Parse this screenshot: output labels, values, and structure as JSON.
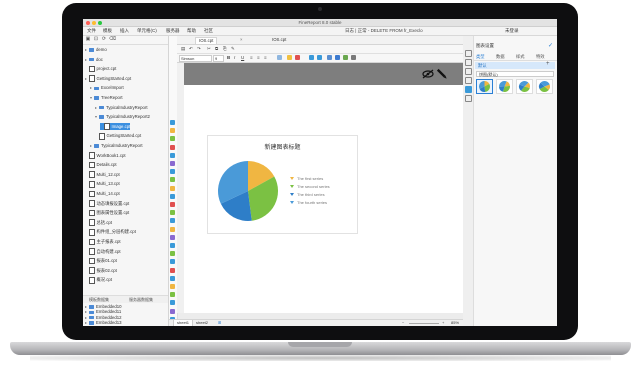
{
  "window": {
    "title": "FineReport 8.0 stable",
    "search_text": "日志 | 正常 - DELETE FROM fr_Execlo",
    "right_header": "未登录"
  },
  "menu": [
    "文件",
    "模板",
    "插入",
    "单元格(C)",
    "服务器",
    "帮助",
    "社区"
  ],
  "left_panel": {
    "tree": [
      {
        "label": "demo",
        "type": "folder",
        "level": 0,
        "caret": "▸"
      },
      {
        "label": "doc",
        "type": "folder",
        "level": 0,
        "caret": "▸"
      },
      {
        "label": "project.cpt",
        "type": "doc",
        "level": 0,
        "caret": ""
      },
      {
        "label": "GettingStarted.cpt",
        "type": "doc",
        "level": 0,
        "caret": "▸"
      },
      {
        "label": "ExcelImport",
        "type": "folder",
        "level": 1,
        "caret": "▸"
      },
      {
        "label": "TreeReport",
        "type": "folder",
        "level": 1,
        "caret": "▾"
      },
      {
        "label": "TypicalIndustryReport",
        "type": "folder",
        "level": 2,
        "caret": "▸"
      },
      {
        "label": "TypicalIndustryReport2",
        "type": "folder",
        "level": 2,
        "caret": "▾"
      },
      {
        "label": "Image.cpt",
        "type": "doc",
        "level": 3,
        "caret": "",
        "selected": true
      },
      {
        "label": "GettingStarted.cpt",
        "type": "doc",
        "level": 2,
        "caret": ""
      },
      {
        "label": "TypicalIndustryReport",
        "type": "folder",
        "level": 1,
        "caret": "▸"
      },
      {
        "label": "WorkBook1.cpt",
        "type": "doc",
        "level": 0,
        "caret": ""
      },
      {
        "label": "Details.cpt",
        "type": "doc",
        "level": 0,
        "caret": ""
      },
      {
        "label": "Multi_12.cpt",
        "type": "doc",
        "level": 0,
        "caret": ""
      },
      {
        "label": "Multi_13.cpt",
        "type": "doc",
        "level": 0,
        "caret": ""
      },
      {
        "label": "Multi_14.cpt",
        "type": "doc",
        "level": 0,
        "caret": ""
      },
      {
        "label": "动态填报设置.cpt",
        "type": "doc",
        "level": 0,
        "caret": ""
      },
      {
        "label": "图表属性设置.cpt",
        "type": "doc",
        "level": 0,
        "caret": ""
      },
      {
        "label": "总括.cpt",
        "type": "doc",
        "level": 0,
        "caret": ""
      },
      {
        "label": "构件组_分层构建.cpt",
        "type": "doc",
        "level": 0,
        "caret": ""
      },
      {
        "label": "主子报表.cpt",
        "type": "doc",
        "level": 0,
        "caret": ""
      },
      {
        "label": "自动构建.cpt",
        "type": "doc",
        "level": 0,
        "caret": ""
      },
      {
        "label": "报表01.cpt",
        "type": "doc",
        "level": 0,
        "caret": ""
      },
      {
        "label": "报表02.cpt",
        "type": "doc",
        "level": 0,
        "caret": ""
      },
      {
        "label": "概况.cpt",
        "type": "doc",
        "level": 0,
        "caret": ""
      }
    ],
    "bottom_tabs": [
      "模板数据集",
      "服务器数据集"
    ],
    "embedded": [
      "Embedded10",
      "Embedded11",
      "Embedded12",
      "Embedded13"
    ]
  },
  "editor": {
    "tabs": [
      "IOS.cpt",
      "IOS.cpt"
    ],
    "font": "Simsun",
    "font_size": "9",
    "sheet_tabs": [
      "sheet1",
      "sheet2"
    ],
    "zoom": "85%"
  },
  "chart_data": {
    "type": "pie",
    "title": "新建图表标题",
    "series": [
      {
        "name": "The first series",
        "value": 17,
        "color": "#f0b642"
      },
      {
        "name": "The second series",
        "value": 31,
        "color": "#7bc143"
      },
      {
        "name": "The third series",
        "value": 20,
        "color": "#2e7ec8"
      },
      {
        "name": "The fourth series",
        "value": 32,
        "color": "#4a9ad8"
      }
    ]
  },
  "right_panel": {
    "title": "图表设置",
    "tabs": [
      "类型",
      "数据",
      "样式",
      "特效"
    ],
    "type_label": "默认",
    "subtype_select": "饼图(默认)",
    "thumb_count": 4
  },
  "colors": {
    "accent": "#2a7fd4",
    "selected_row": "#3b8fe0",
    "gray_header": "#7e7e7e"
  }
}
